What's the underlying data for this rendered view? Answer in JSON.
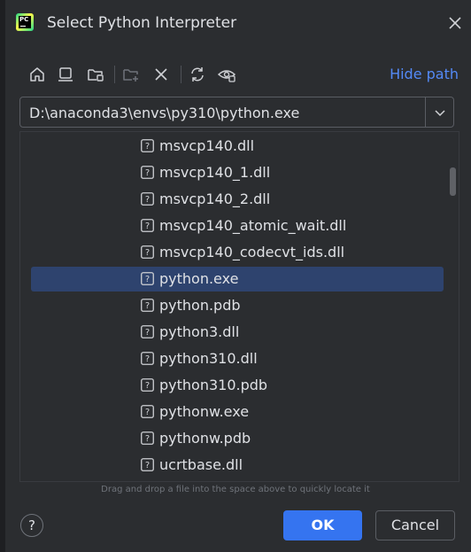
{
  "window": {
    "title": "Select Python Interpreter",
    "logo_text": "PC"
  },
  "toolbar": {
    "icons": [
      "home-icon",
      "desktop-icon",
      "project-folder-icon",
      "new-folder-icon",
      "delete-icon",
      "refresh-icon",
      "show-hidden-icon"
    ],
    "hide_path_label": "Hide path"
  },
  "path": {
    "value": "D:\\anaconda3\\envs\\py310\\python.exe"
  },
  "files": [
    {
      "name": "msvcp140.dll",
      "icon": "unknown-file-icon",
      "selected": false
    },
    {
      "name": "msvcp140_1.dll",
      "icon": "unknown-file-icon",
      "selected": false
    },
    {
      "name": "msvcp140_2.dll",
      "icon": "unknown-file-icon",
      "selected": false
    },
    {
      "name": "msvcp140_atomic_wait.dll",
      "icon": "unknown-file-icon",
      "selected": false
    },
    {
      "name": "msvcp140_codecvt_ids.dll",
      "icon": "unknown-file-icon",
      "selected": false
    },
    {
      "name": "python.exe",
      "icon": "unknown-file-icon",
      "selected": true
    },
    {
      "name": "python.pdb",
      "icon": "unknown-file-icon",
      "selected": false
    },
    {
      "name": "python3.dll",
      "icon": "unknown-file-icon",
      "selected": false
    },
    {
      "name": "python310.dll",
      "icon": "unknown-file-icon",
      "selected": false
    },
    {
      "name": "python310.pdb",
      "icon": "unknown-file-icon",
      "selected": false
    },
    {
      "name": "pythonw.exe",
      "icon": "unknown-file-icon",
      "selected": false
    },
    {
      "name": "pythonw.pdb",
      "icon": "unknown-file-icon",
      "selected": false
    },
    {
      "name": "ucrtbase.dll",
      "icon": "unknown-file-icon",
      "selected": false
    }
  ],
  "hint": "Drag and drop a file into the space above to quickly locate it",
  "footer": {
    "help_label": "?",
    "ok_label": "OK",
    "cancel_label": "Cancel"
  },
  "colors": {
    "background": "#2b2d30",
    "accent": "#3574f0",
    "link": "#548af7",
    "selection": "#2e436e"
  }
}
